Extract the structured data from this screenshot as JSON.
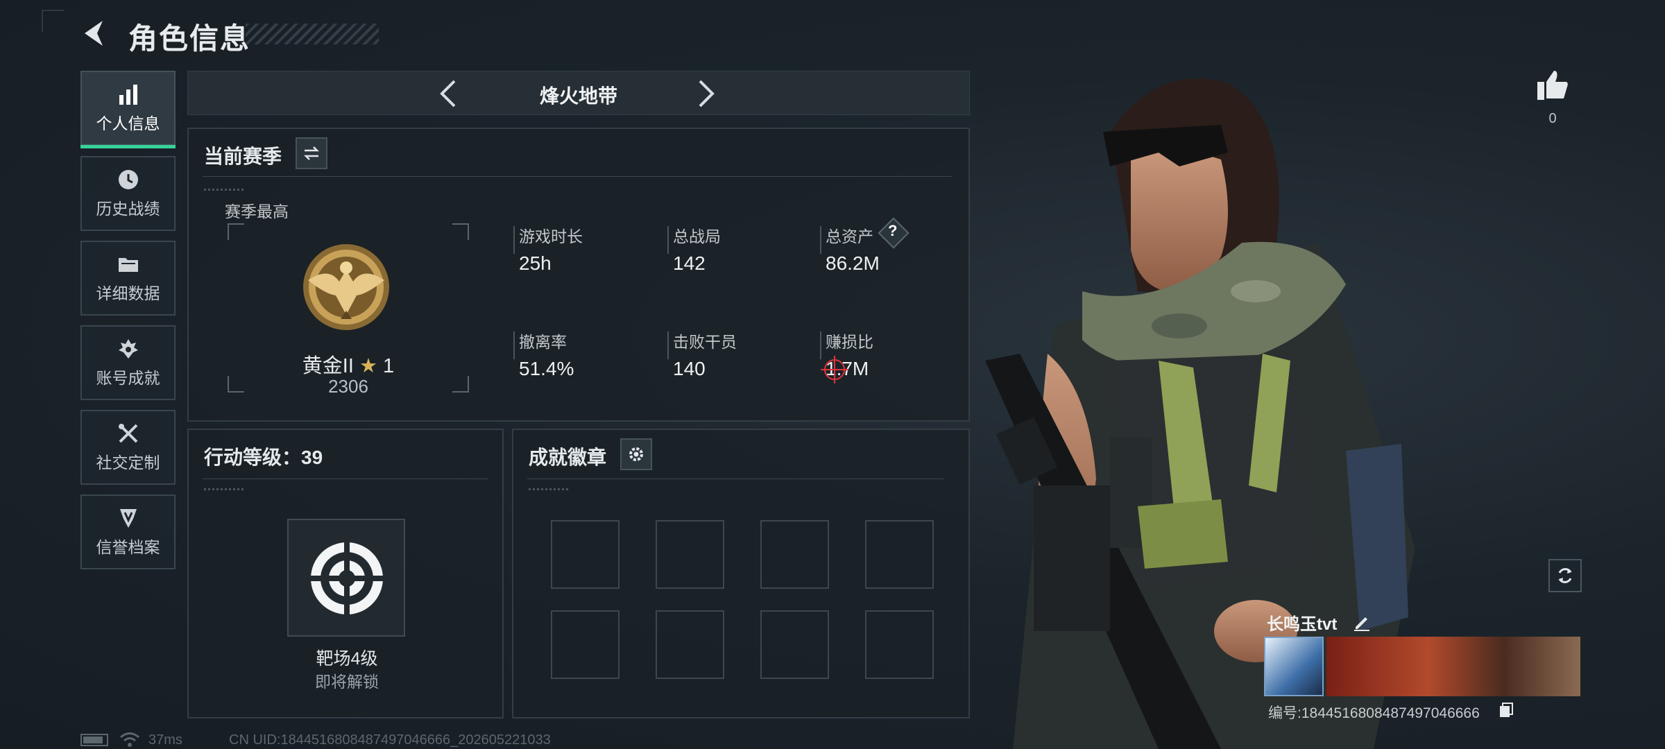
{
  "header": {
    "title": "角色信息"
  },
  "nav": [
    "个人信息",
    "历史战绩",
    "详细数据",
    "账号成就",
    "社交定制",
    "信誉档案"
  ],
  "mode": {
    "title": "烽火地带"
  },
  "season": {
    "title": "当前赛季",
    "best_label": "赛季最高",
    "rank": "黄金II",
    "rank_stars": "1",
    "score": "2306",
    "stats": [
      {
        "label": "游戏时长",
        "value": "25h"
      },
      {
        "label": "总战局",
        "value": "142"
      },
      {
        "label": "总资产",
        "value": "86.2M"
      },
      {
        "label": "撤离率",
        "value": "51.4%"
      },
      {
        "label": "击败干员",
        "value": "140"
      },
      {
        "label": "赚损比",
        "value": "1.7M"
      }
    ]
  },
  "action": {
    "label": "行动等级：",
    "level": "39",
    "unlock_title": "靶场4级",
    "unlock_status": "即将解锁"
  },
  "badges": {
    "title": "成就徽章"
  },
  "likes": {
    "count": "0"
  },
  "player": {
    "name": "长鸣玉tvt",
    "id_label": "编号:",
    "id": "18445168084874970466​6"
  },
  "status": {
    "ping": "37ms",
    "uid": "CN UID:18445168084874970466​6_202605221033"
  },
  "colors": {
    "accent": "#35d39a",
    "crosshair": "#e0343a",
    "gold": "#c9a25a"
  }
}
